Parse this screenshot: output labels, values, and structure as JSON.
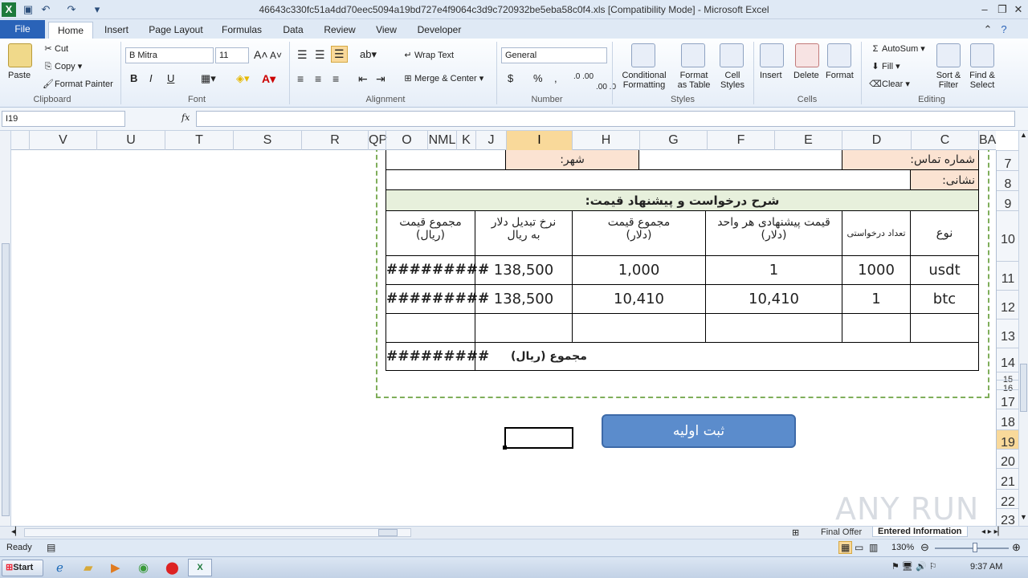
{
  "window": {
    "title": "46643c330fc51a4dd70eec5094a19bd727e4f9064c3d9c720932be5eba58c0f4.xls  [Compatibility Mode]  -  Microsoft Excel",
    "app_icon_letter": "X"
  },
  "ribbon_tabs": [
    "File",
    "Home",
    "Insert",
    "Page Layout",
    "Formulas",
    "Data",
    "Review",
    "View",
    "Developer"
  ],
  "clipboard": {
    "paste": "Paste",
    "cut": "Cut",
    "copy": "Copy",
    "format_painter": "Format Painter",
    "label": "Clipboard"
  },
  "font": {
    "name": "B Mitra",
    "size": "11",
    "label": "Font",
    "bold": "B",
    "italic": "I",
    "underline": "U"
  },
  "alignment": {
    "wrap": "Wrap Text",
    "merge": "Merge & Center",
    "label": "Alignment"
  },
  "number": {
    "format": "General",
    "label": "Number",
    "currency": "$",
    "percent": "%",
    "comma": ",",
    "inc_dec": ".0 .00",
    "dec_dec": ".00 .0"
  },
  "styles": {
    "conditional_1": "Conditional",
    "conditional_2": "Formatting",
    "format_table_1": "Format",
    "format_table_2": "as Table",
    "cell_styles_1": "Cell",
    "cell_styles_2": "Styles",
    "label": "Styles"
  },
  "cells": {
    "insert": "Insert",
    "delete": "Delete",
    "format": "Format",
    "label": "Cells"
  },
  "editing": {
    "autosum": "AutoSum",
    "fill": "Fill",
    "clear": "Clear",
    "sort_1": "Sort &",
    "sort_2": "Filter",
    "find_1": "Find &",
    "find_2": "Select",
    "label": "Editing"
  },
  "formula_bar": {
    "name_box": "I19",
    "fx": "fx",
    "content": ""
  },
  "columns": [
    {
      "label": "V",
      "sel": false
    },
    {
      "label": "U",
      "sel": false
    },
    {
      "label": "T",
      "sel": false
    },
    {
      "label": "S",
      "sel": false
    },
    {
      "label": "R",
      "sel": false
    },
    {
      "label": "QP",
      "sel": false
    },
    {
      "label": "O",
      "sel": false
    },
    {
      "label": "NML",
      "sel": false
    },
    {
      "label": "K",
      "sel": false
    },
    {
      "label": "J",
      "sel": false
    },
    {
      "label": "I",
      "sel": true
    },
    {
      "label": "H",
      "sel": false
    },
    {
      "label": "G",
      "sel": false
    },
    {
      "label": "F",
      "sel": false
    },
    {
      "label": "E",
      "sel": false
    },
    {
      "label": "D",
      "sel": false
    },
    {
      "label": "C",
      "sel": false
    },
    {
      "label": "BA",
      "sel": false
    }
  ],
  "rows": [
    {
      "label": "7",
      "sel": false
    },
    {
      "label": "8",
      "sel": false
    },
    {
      "label": "9",
      "sel": false
    },
    {
      "label": "10",
      "sel": false
    },
    {
      "label": "11",
      "sel": false
    },
    {
      "label": "12",
      "sel": false
    },
    {
      "label": "13",
      "sel": false
    },
    {
      "label": "14",
      "sel": false
    },
    {
      "label": "15",
      "sel": false
    },
    {
      "label": "16",
      "sel": false
    },
    {
      "label": "17",
      "sel": false
    },
    {
      "label": "18",
      "sel": false
    },
    {
      "label": "19",
      "sel": true
    },
    {
      "label": "20",
      "sel": false
    },
    {
      "label": "21",
      "sel": false
    },
    {
      "label": "22",
      "sel": false
    },
    {
      "label": "23",
      "sel": false
    }
  ],
  "form": {
    "contact_label": "شماره تماس:",
    "city_label": "شهر:",
    "address_label": "نشانی:",
    "section_title": "شرح درخواست و پیشنهاد قیمت:",
    "headers": {
      "type": "نوع",
      "qty": "تعداد درخواستی",
      "unit_price_1": "قیمت پیشنهادی هر واحد",
      "unit_price_2": "(دلار)",
      "total_usd_1": "مجموع قیمت",
      "total_usd_2": "(دلار)",
      "rate_1": "نرخ تبدیل دلار",
      "rate_2": "به ریال",
      "total_rial_1": "مجموع قیمت",
      "total_rial_2": "(ریال)"
    },
    "rows": [
      {
        "type": "usdt",
        "qty": "1000",
        "unit": "1",
        "total_usd": "1,000",
        "rate": "138,500",
        "total_rial": "#########"
      },
      {
        "type": "btc",
        "qty": "1",
        "unit": "10,410",
        "total_usd": "10,410",
        "rate": "138,500",
        "total_rial": "#########"
      }
    ],
    "sum_label": "مجموع (ریال)",
    "sum_value": "#########"
  },
  "submit_button": "ثبت اولیه",
  "sheet_tabs": [
    "Final Offer",
    "Entered Information"
  ],
  "status": {
    "ready": "Ready",
    "zoom": "130%"
  },
  "taskbar": {
    "start": "Start",
    "time": "9:37 AM"
  },
  "watermark": "ANY RUN"
}
